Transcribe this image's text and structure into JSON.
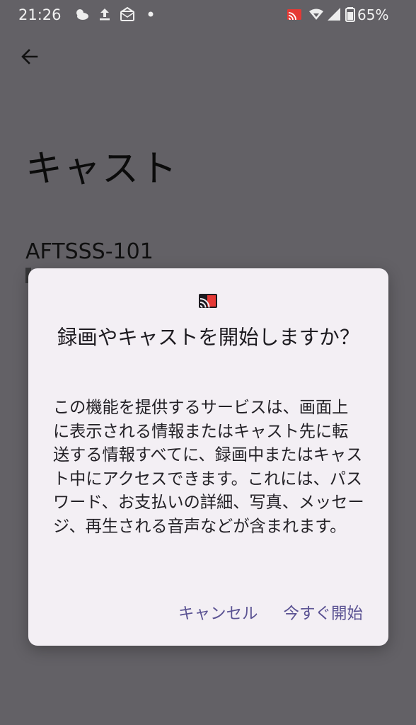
{
  "status_bar": {
    "time": "21:26",
    "battery": "65%",
    "icons": [
      "weather-icon",
      "upload-icon",
      "mail-icon",
      "dot-icon",
      "cast-icon",
      "wifi-icon",
      "signal-icon",
      "battery-icon"
    ]
  },
  "page": {
    "title": "キャスト",
    "device_name": "AFTSSS-101"
  },
  "dialog": {
    "title": "録画やキャストを開始しますか？",
    "body": "この機能を提供するサービスは、画面上に表示される情報またはキャスト先に転送する情報すべてに、録画中またはキャスト中にアクセスできます。これには、パスワード、お支払いの詳細、写真、メッセージ、再生される音声などが含まれます。",
    "cancel_label": "キャンセル",
    "start_label": "今すぐ開始"
  },
  "colors": {
    "background": "#636166",
    "dialog_bg": "#f3eff4",
    "accent": "#5b5393",
    "cast_red": "#e53935"
  }
}
